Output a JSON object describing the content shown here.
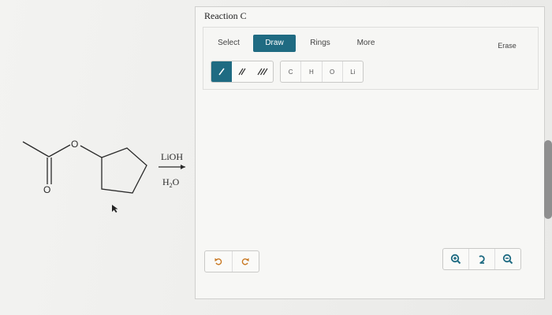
{
  "reaction": {
    "reagent_top": "LiOH",
    "reagent_bottom_main": "H",
    "reagent_bottom_sub": "2",
    "reagent_bottom_end": "O",
    "atom_O_ester": "O",
    "atom_O_carbonyl": "O"
  },
  "editor": {
    "title": "Reaction C",
    "tabs": {
      "select": "Select",
      "draw": "Draw",
      "rings": "Rings",
      "more": "More",
      "erase": "Erase"
    },
    "active_tab": "Draw",
    "atoms": [
      "C",
      "H",
      "O",
      "Li"
    ],
    "accent_color": "#1f6b82"
  },
  "icons": {
    "bonds": [
      "single-bond-icon",
      "double-bond-icon",
      "triple-bond-icon"
    ],
    "history": [
      "undo-icon",
      "redo-icon"
    ],
    "zoom": [
      "zoom-in-icon",
      "zoom-reset-icon",
      "zoom-out-icon"
    ]
  }
}
